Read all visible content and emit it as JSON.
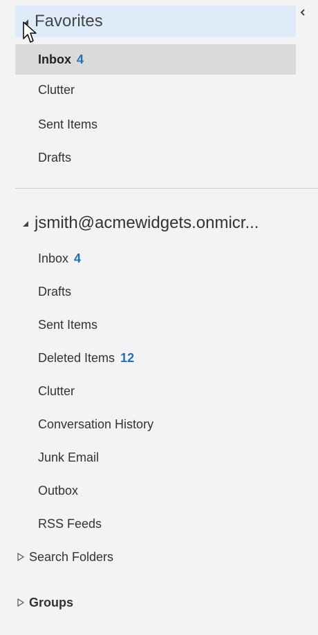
{
  "favorites": {
    "title": "Favorites",
    "items": [
      {
        "label": "Inbox",
        "count": "4",
        "selected": true
      },
      {
        "label": "Clutter",
        "count": ""
      },
      {
        "label": "Sent Items",
        "count": ""
      },
      {
        "label": "Drafts",
        "count": ""
      }
    ]
  },
  "account": {
    "title": "jsmith@acmewidgets.onmicr...",
    "items": [
      {
        "label": "Inbox",
        "count": "4"
      },
      {
        "label": "Drafts",
        "count": ""
      },
      {
        "label": "Sent Items",
        "count": ""
      },
      {
        "label": "Deleted Items",
        "count": "12"
      },
      {
        "label": "Clutter",
        "count": ""
      },
      {
        "label": "Conversation History",
        "count": ""
      },
      {
        "label": "Junk Email",
        "count": ""
      },
      {
        "label": "Outbox",
        "count": ""
      },
      {
        "label": "RSS Feeds",
        "count": ""
      }
    ],
    "search_folders_label": "Search Folders"
  },
  "groups": {
    "label": "Groups"
  },
  "colors": {
    "accent": "#1e6fbf",
    "selected_bg": "#dadada",
    "header_bg": "#deecf9",
    "pane_bg": "#f3f3f3"
  },
  "icons": {
    "collapse": "chevron-left-icon",
    "expanded": "triangle-expanded-icon",
    "collapsed": "triangle-collapsed-icon",
    "cursor": "mouse-pointer-icon"
  }
}
